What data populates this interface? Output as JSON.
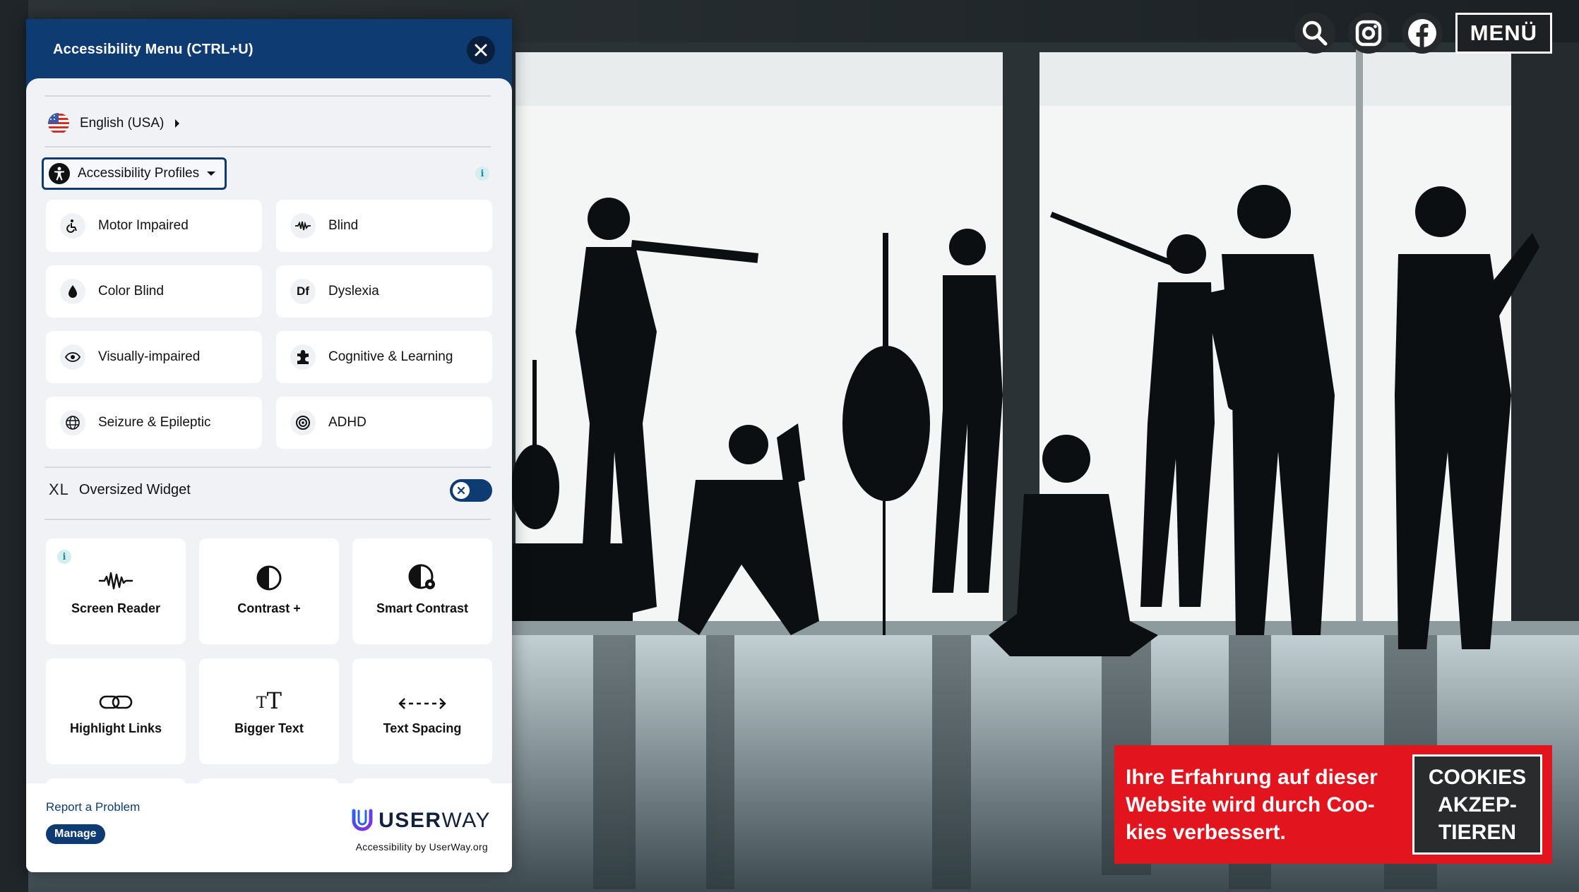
{
  "top_icons": {
    "search": "search-icon",
    "instagram": "instagram-icon",
    "facebook": "facebook-icon",
    "menu_label": "MENÜ"
  },
  "cookie_banner": {
    "text_lines": [
      "Ihre Erfahrung auf dieser",
      "Website wird durch Coo-",
      "kies verbessert."
    ],
    "button_lines": [
      "COOKIES",
      "AKZEP-",
      "TIEREN"
    ],
    "color": "#e2141e"
  },
  "panel": {
    "title": "Accessibility Menu (CTRL+U)",
    "language": "English (USA)",
    "profiles_label": "Accessibility Profiles",
    "info_glyph": "i",
    "profiles": [
      {
        "label": "Motor Impaired",
        "icon": "wheelchair-icon"
      },
      {
        "label": "Blind",
        "icon": "soundwave-icon"
      },
      {
        "label": "Color Blind",
        "icon": "droplet-icon"
      },
      {
        "label": "Dyslexia",
        "icon": "df-icon",
        "glyph": "Df"
      },
      {
        "label": "Visually-impaired",
        "icon": "eye-icon"
      },
      {
        "label": "Cognitive & Learning",
        "icon": "puzzle-icon"
      },
      {
        "label": "Seizure & Epileptic",
        "icon": "globe-icon"
      },
      {
        "label": "ADHD",
        "icon": "target-icon"
      }
    ],
    "oversized": {
      "glyph": "XL",
      "label": "Oversized Widget",
      "enabled": false
    },
    "tools": [
      {
        "label": "Screen Reader",
        "icon": "soundwave-icon"
      },
      {
        "label": "Contrast +",
        "icon": "contrast-icon"
      },
      {
        "label": "Smart Contrast",
        "icon": "smart-contrast-icon"
      },
      {
        "label": "Highlight Links",
        "icon": "link-icon"
      },
      {
        "label": "Bigger Text",
        "icon": "bigger-text-icon",
        "glyph": "TT"
      },
      {
        "label": "Text Spacing",
        "icon": "text-spacing-icon"
      }
    ],
    "footer": {
      "report": "Report a Problem",
      "manage": "Manage",
      "brand_user": "USER",
      "brand_way": "WAY",
      "brand_sub": "Accessibility by UserWay.org"
    },
    "accent_color": "#0e3b72"
  }
}
